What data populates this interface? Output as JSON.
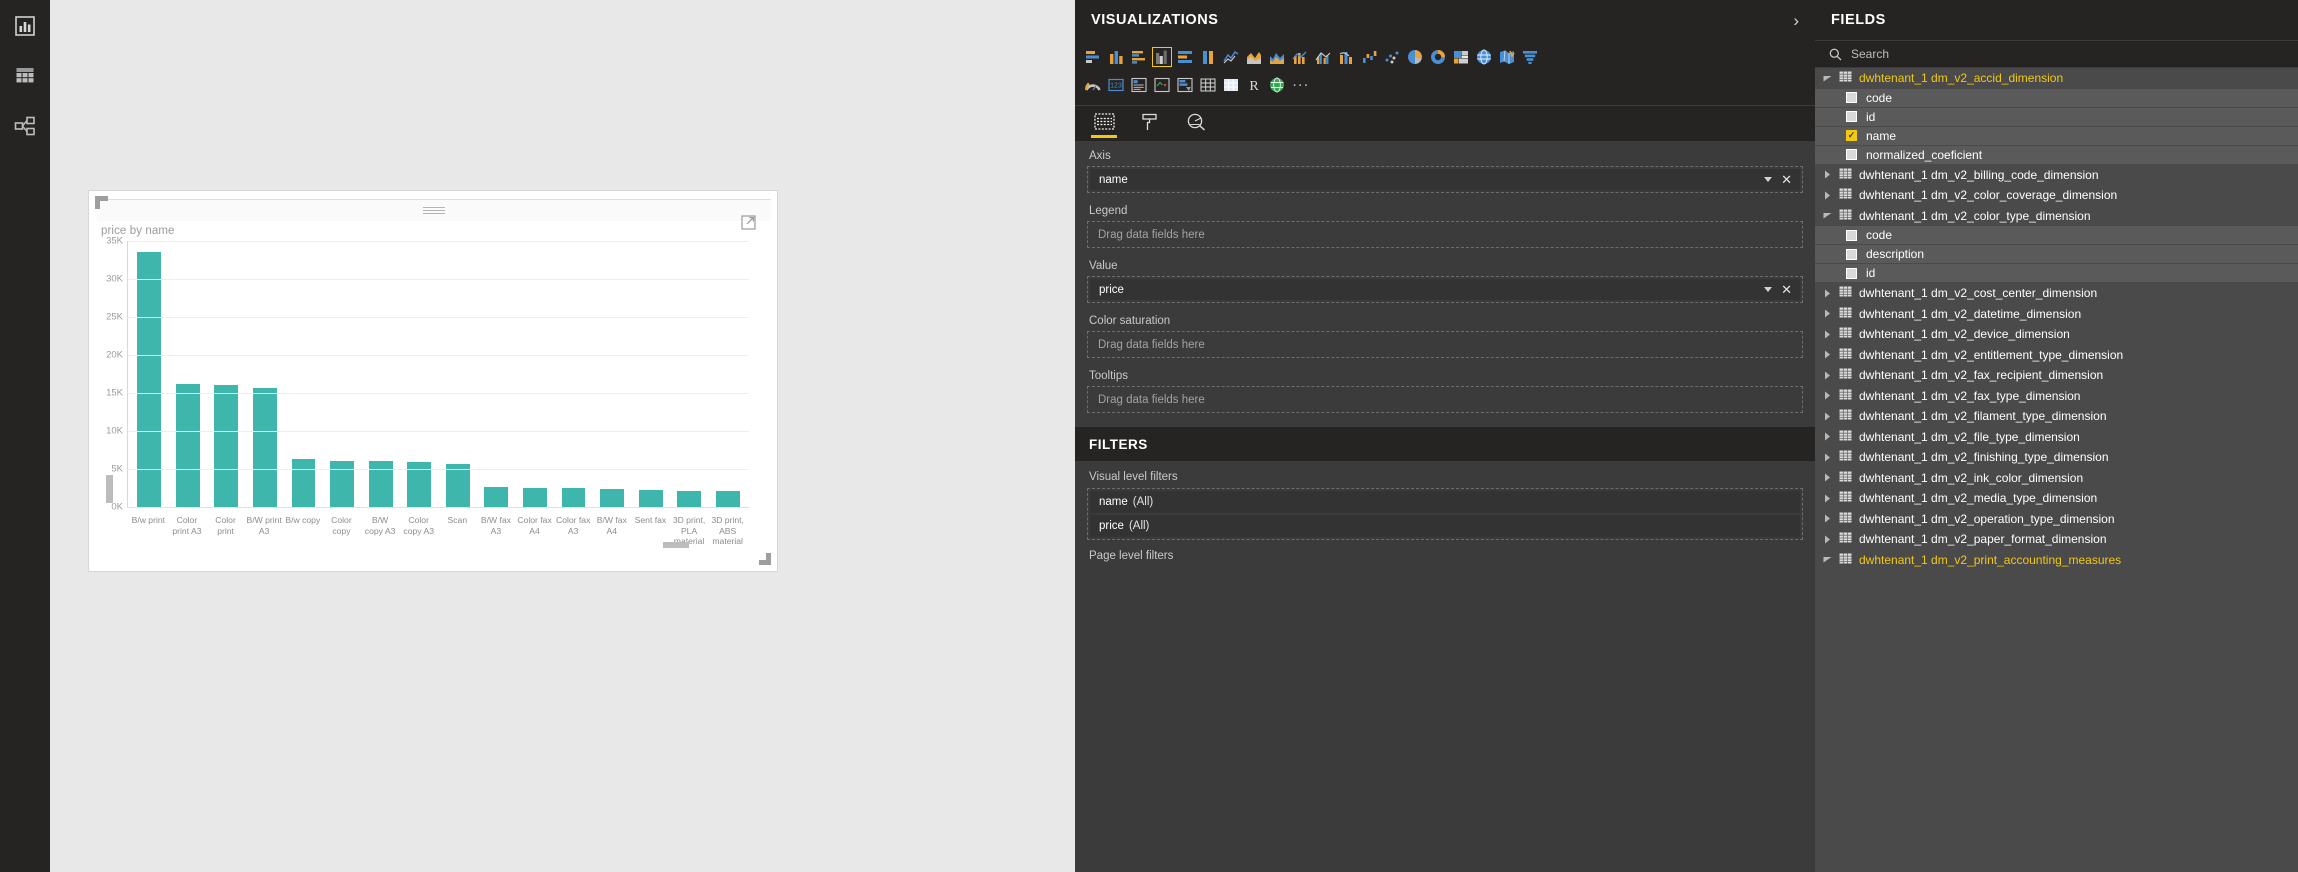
{
  "nav_rail": {
    "items": [
      {
        "name": "report-view",
        "icon": "bar-chart-icon"
      },
      {
        "name": "data-view",
        "icon": "table-grid-icon"
      },
      {
        "name": "model-view",
        "icon": "relationships-icon"
      }
    ]
  },
  "visual": {
    "focus_icon": "focus-mode-icon",
    "more_icon": "more-options-icon",
    "drag_handle": "drag-handle-icon"
  },
  "chart_data": {
    "type": "bar",
    "title": "price by name",
    "xlabel": "",
    "ylabel": "",
    "ylim": [
      0,
      35000
    ],
    "grid": true,
    "legend": false,
    "ytick_labels": [
      "35K",
      "30K",
      "25K",
      "20K",
      "15K",
      "10K",
      "5K",
      "0K"
    ],
    "ytick_values": [
      35000,
      30000,
      25000,
      20000,
      15000,
      10000,
      5000,
      0
    ],
    "categories": [
      "B/w print",
      "Color print A3",
      "Color print",
      "B/W print A3",
      "B/w copy",
      "Color copy",
      "B/W copy A3",
      "Color copy A3",
      "Scan",
      "B/W fax A3",
      "Color fax A4",
      "Color fax A3",
      "B/W fax A4",
      "Sent fax",
      "3D print, PLA material",
      "3D print, ABS material"
    ],
    "values": [
      33500,
      16200,
      16100,
      15600,
      6300,
      6100,
      6050,
      5900,
      5700,
      2600,
      2550,
      2500,
      2400,
      2250,
      2150,
      2100
    ],
    "series": [
      {
        "name": "price",
        "color": "#3fb6ab",
        "values": [
          33500,
          16200,
          16100,
          15600,
          6300,
          6100,
          6050,
          5900,
          5700,
          2600,
          2550,
          2500,
          2400,
          2250,
          2150,
          2100
        ]
      }
    ]
  },
  "visualizations": {
    "title": "VISUALIZATIONS",
    "collapse_icon": "chevron-right-icon",
    "more_label": "...",
    "icons_row1": [
      "stacked-bar-chart-icon",
      "stacked-column-chart-icon",
      "clustered-bar-chart-icon",
      "clustered-column-chart-icon",
      "100-stacked-bar-chart-icon",
      "100-stacked-column-chart-icon",
      "line-chart-icon",
      "area-chart-icon",
      "stacked-area-chart-icon",
      "line-stacked-column-chart-icon",
      "line-clustered-column-chart-icon",
      "ribbon-chart-icon",
      "waterfall-chart-icon",
      "scatter-chart-icon",
      "pie-chart-icon",
      "donut-chart-icon",
      "treemap-icon",
      "map-icon",
      "filled-map-icon",
      "funnel-chart-icon"
    ],
    "icons_row2": [
      "gauge-icon",
      "card-icon",
      "multi-row-card-icon",
      "kpi-icon",
      "slicer-icon",
      "table-icon",
      "matrix-icon",
      "r-script-visual-icon",
      "arcgis-map-icon"
    ],
    "selected_icon": "clustered-column-chart-icon",
    "well_tabs": [
      {
        "name": "fields-tab",
        "icon": "fields-well-icon",
        "active": true
      },
      {
        "name": "format-tab",
        "icon": "paint-roller-icon",
        "active": false
      },
      {
        "name": "analytics-tab",
        "icon": "analytics-magnifier-icon",
        "active": false
      }
    ],
    "wells": [
      {
        "label": "Axis",
        "value": "name",
        "placeholder": "",
        "filled": true
      },
      {
        "label": "Legend",
        "value": "",
        "placeholder": "Drag data fields here",
        "filled": false
      },
      {
        "label": "Value",
        "value": "price",
        "placeholder": "",
        "filled": true
      },
      {
        "label": "Color saturation",
        "value": "",
        "placeholder": "Drag data fields here",
        "filled": false
      },
      {
        "label": "Tooltips",
        "value": "",
        "placeholder": "Drag data fields here",
        "filled": false
      }
    ]
  },
  "filters": {
    "title": "FILTERS",
    "visual_level_label": "Visual level filters",
    "visual_level_items": [
      {
        "field": "name",
        "state": "(All)"
      },
      {
        "field": "price",
        "state": "(All)"
      }
    ],
    "page_level_label": "Page level filters"
  },
  "fields": {
    "title": "FIELDS",
    "search_placeholder": "Search",
    "search_icon": "search-icon",
    "tables": [
      {
        "name": "dwhtenant_1 dm_v2_accid_dimension",
        "expanded": true,
        "highlighted": true,
        "fields": [
          {
            "name": "code",
            "checked": false
          },
          {
            "name": "id",
            "checked": false
          },
          {
            "name": "name",
            "checked": true
          },
          {
            "name": "normalized_coeficient",
            "checked": false
          }
        ]
      },
      {
        "name": "dwhtenant_1 dm_v2_billing_code_dimension",
        "expanded": false,
        "highlighted": false,
        "fields": []
      },
      {
        "name": "dwhtenant_1 dm_v2_color_coverage_dimension",
        "expanded": false,
        "highlighted": false,
        "fields": []
      },
      {
        "name": "dwhtenant_1 dm_v2_color_type_dimension",
        "expanded": true,
        "highlighted": false,
        "fields": [
          {
            "name": "code",
            "checked": false
          },
          {
            "name": "description",
            "checked": false
          },
          {
            "name": "id",
            "checked": false
          }
        ]
      },
      {
        "name": "dwhtenant_1 dm_v2_cost_center_dimension",
        "expanded": false,
        "highlighted": false,
        "fields": []
      },
      {
        "name": "dwhtenant_1 dm_v2_datetime_dimension",
        "expanded": false,
        "highlighted": false,
        "fields": []
      },
      {
        "name": "dwhtenant_1 dm_v2_device_dimension",
        "expanded": false,
        "highlighted": false,
        "fields": []
      },
      {
        "name": "dwhtenant_1 dm_v2_entitlement_type_dimension",
        "expanded": false,
        "highlighted": false,
        "fields": []
      },
      {
        "name": "dwhtenant_1 dm_v2_fax_recipient_dimension",
        "expanded": false,
        "highlighted": false,
        "fields": []
      },
      {
        "name": "dwhtenant_1 dm_v2_fax_type_dimension",
        "expanded": false,
        "highlighted": false,
        "fields": []
      },
      {
        "name": "dwhtenant_1 dm_v2_filament_type_dimension",
        "expanded": false,
        "highlighted": false,
        "fields": []
      },
      {
        "name": "dwhtenant_1 dm_v2_file_type_dimension",
        "expanded": false,
        "highlighted": false,
        "fields": []
      },
      {
        "name": "dwhtenant_1 dm_v2_finishing_type_dimension",
        "expanded": false,
        "highlighted": false,
        "fields": []
      },
      {
        "name": "dwhtenant_1 dm_v2_ink_color_dimension",
        "expanded": false,
        "highlighted": false,
        "fields": []
      },
      {
        "name": "dwhtenant_1 dm_v2_media_type_dimension",
        "expanded": false,
        "highlighted": false,
        "fields": []
      },
      {
        "name": "dwhtenant_1 dm_v2_operation_type_dimension",
        "expanded": false,
        "highlighted": false,
        "fields": []
      },
      {
        "name": "dwhtenant_1 dm_v2_paper_format_dimension",
        "expanded": false,
        "highlighted": false,
        "fields": []
      },
      {
        "name": "dwhtenant_1 dm_v2_print_accounting_measures",
        "expanded": true,
        "highlighted": true,
        "fields": []
      }
    ]
  },
  "colors": {
    "bar": "#3fb6ab",
    "accent": "#f2c811",
    "pane_dark": "#252423",
    "pane_mid": "#3b3b3b",
    "fields_bg": "#4a4a4a"
  }
}
